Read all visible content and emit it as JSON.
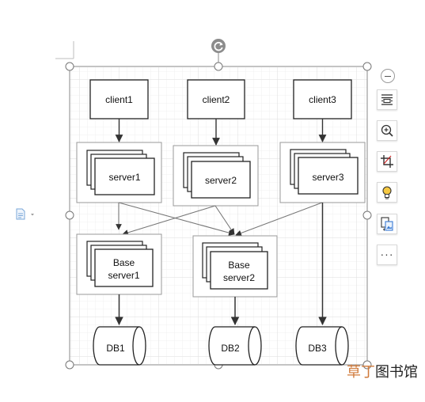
{
  "diagram": {
    "clients": [
      "client1",
      "client2",
      "client3"
    ],
    "servers": [
      "server1",
      "server2",
      "server3"
    ],
    "base_servers": [
      {
        "line1": "Base",
        "line2": "server1"
      },
      {
        "line1": "Base",
        "line2": "server2"
      }
    ],
    "databases": [
      "DB1",
      "DB2",
      "DB3"
    ]
  },
  "toolbar": {
    "more_label": "···"
  },
  "watermark": {
    "accent": "草丁",
    "rest": "图书馆"
  },
  "icons": {
    "rotate": "rotate-icon",
    "minus": "minus-icon",
    "wrap": "text-wrap-icon",
    "zoom": "zoom-in-icon",
    "crop": "crop-icon",
    "idea": "lightbulb-icon",
    "export": "export-image-icon",
    "doc": "document-icon"
  },
  "colors": {
    "selection": "#8a8a8a",
    "grid": "#e6e6e6",
    "shape_stroke": "#222222",
    "group_border": "#9a9a9a",
    "rotate_handle": "#8c8c8c",
    "doc_icon": "#7aa7d8",
    "watermark_accent": "#d07a3a"
  }
}
